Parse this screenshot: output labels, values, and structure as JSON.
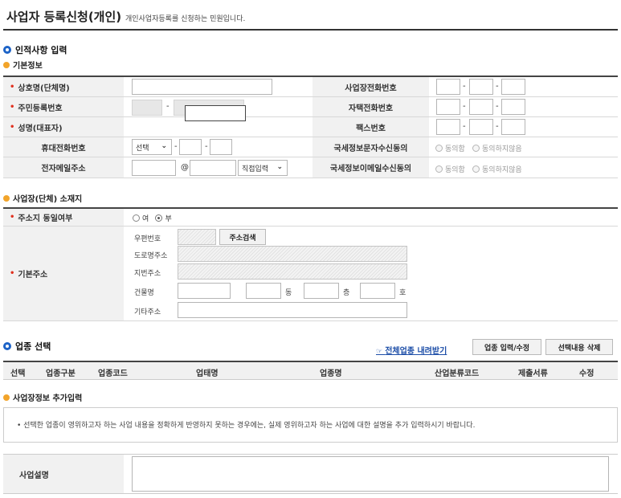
{
  "page": {
    "title": "사업자 등록신청(개인)",
    "description": "개인사업자등록를 신청하는 민원입니다."
  },
  "personal": {
    "heading": "인적사항 입력",
    "subheading": "기본정보",
    "trade_name_label": "상호명(단체명)",
    "business_phone_label": "사업장전화번호",
    "resident_no_label": "주민등록번호",
    "home_phone_label": "자택전화번호",
    "name_label": "성명(대표자)",
    "fax_label": "팩스번호",
    "mobile_label": "휴대전화번호",
    "mobile_select": "선택",
    "sms_consent_label": "국세정보문자수신동의",
    "email_label": "전자메일주소",
    "email_at": "@",
    "email_domain_select": "직접입력",
    "email_consent_label": "국세정보이메일수신동의",
    "agree": "동의함",
    "disagree": "동의하지않음",
    "dash": "-"
  },
  "address": {
    "subheading": "사업장(단체) 소재지",
    "same_label": "주소지 동일여부",
    "yes": "여",
    "no": "부",
    "base_label": "기본주소",
    "postal_label": "우편번호",
    "search_button": "주소검색",
    "road_label": "도로명주소",
    "lot_label": "지번주소",
    "building_label": "건물명",
    "dong": "동",
    "floor": "층",
    "unit": "호",
    "other_label": "기타주소"
  },
  "industry": {
    "heading": "업종 선택",
    "download_link": "전체업종 내려받기",
    "input_button": "업종 입력/수정",
    "delete_button": "선택내용 삭제",
    "columns": [
      "선택",
      "업종구분",
      "업종코드",
      "업태명",
      "업종명",
      "산업분류코드",
      "제출서류",
      "수정"
    ]
  },
  "extra": {
    "subheading": "사업장정보 추가입력",
    "notice": "• 선택한 업종이 영위하고자 하는 사업 내용을 정확하게 반영하지 못하는 경우에는, 실제 영위하고자 하는 사업에 대한 설명을 추가 입력하시기 바랍니다.",
    "description_label": "사업설명"
  },
  "colors": {
    "accent_blue": "#1d63c7",
    "bullet_orange": "#f2a42a",
    "required_star": "#e0301e",
    "link": "#1d4ea8"
  }
}
